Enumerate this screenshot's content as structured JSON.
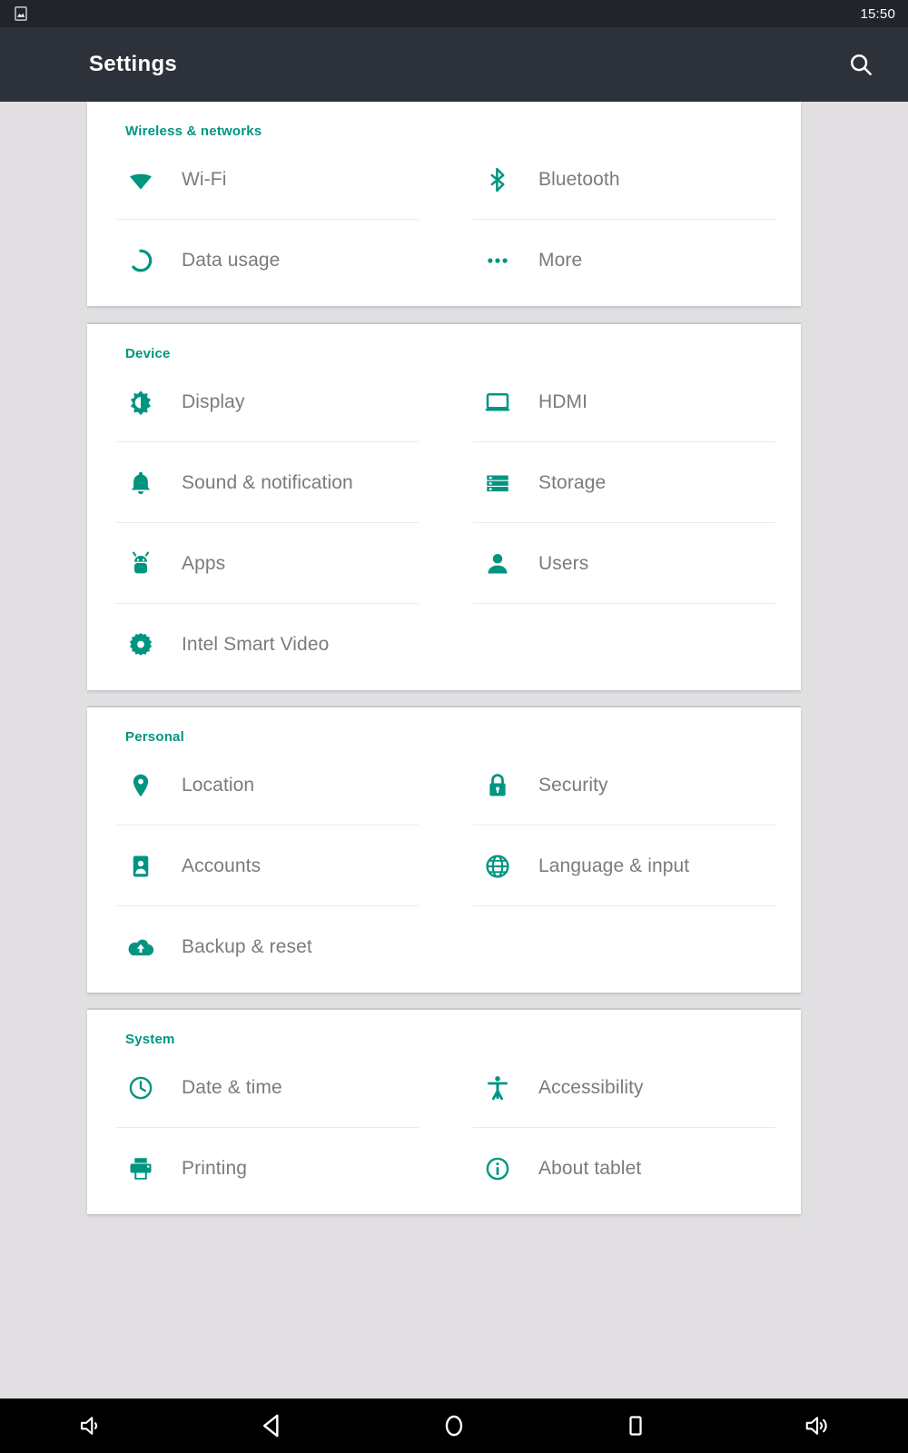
{
  "status_bar": {
    "icon": "photo-icon",
    "time": "15:50"
  },
  "app_bar": {
    "title": "Settings",
    "search_icon": "search-icon"
  },
  "theme": {
    "accent": "#009581",
    "label_color": "#7b7b7b",
    "card_bg": "#ffffff",
    "page_bg": "#e1dfe2",
    "status_bar_bg": "#21242a",
    "app_bar_bg": "#2c313a",
    "nav_bar_bg": "#000000"
  },
  "sections": [
    {
      "title": "Wireless & networks",
      "items": [
        {
          "label": "Wi-Fi",
          "icon": "wifi-icon"
        },
        {
          "label": "Bluetooth",
          "icon": "bluetooth-icon"
        },
        {
          "label": "Data usage",
          "icon": "data-usage-icon"
        },
        {
          "label": "More",
          "icon": "more-horizontal-icon"
        }
      ]
    },
    {
      "title": "Device",
      "items": [
        {
          "label": "Display",
          "icon": "brightness-icon"
        },
        {
          "label": "HDMI",
          "icon": "monitor-icon"
        },
        {
          "label": "Sound & notification",
          "icon": "bell-icon"
        },
        {
          "label": "Storage",
          "icon": "storage-icon"
        },
        {
          "label": "Apps",
          "icon": "android-icon"
        },
        {
          "label": "Users",
          "icon": "person-icon"
        },
        {
          "label": "Intel Smart Video",
          "icon": "gear-icon"
        }
      ]
    },
    {
      "title": "Personal",
      "items": [
        {
          "label": "Location",
          "icon": "location-pin-icon"
        },
        {
          "label": "Security",
          "icon": "lock-icon"
        },
        {
          "label": "Accounts",
          "icon": "account-box-icon"
        },
        {
          "label": "Language & input",
          "icon": "globe-icon"
        },
        {
          "label": "Backup & reset",
          "icon": "cloud-upload-icon"
        }
      ]
    },
    {
      "title": "System",
      "items": [
        {
          "label": "Date & time",
          "icon": "clock-icon"
        },
        {
          "label": "Accessibility",
          "icon": "accessibility-icon"
        },
        {
          "label": "Printing",
          "icon": "printer-icon"
        },
        {
          "label": "About tablet",
          "icon": "info-icon"
        }
      ]
    }
  ],
  "nav_bar": {
    "buttons": [
      {
        "name": "volume-down-button",
        "icon": "volume-down-icon"
      },
      {
        "name": "back-button",
        "icon": "back-triangle-icon"
      },
      {
        "name": "home-button",
        "icon": "home-circle-icon"
      },
      {
        "name": "recents-button",
        "icon": "recents-square-icon"
      },
      {
        "name": "volume-up-button",
        "icon": "volume-up-icon"
      }
    ]
  }
}
